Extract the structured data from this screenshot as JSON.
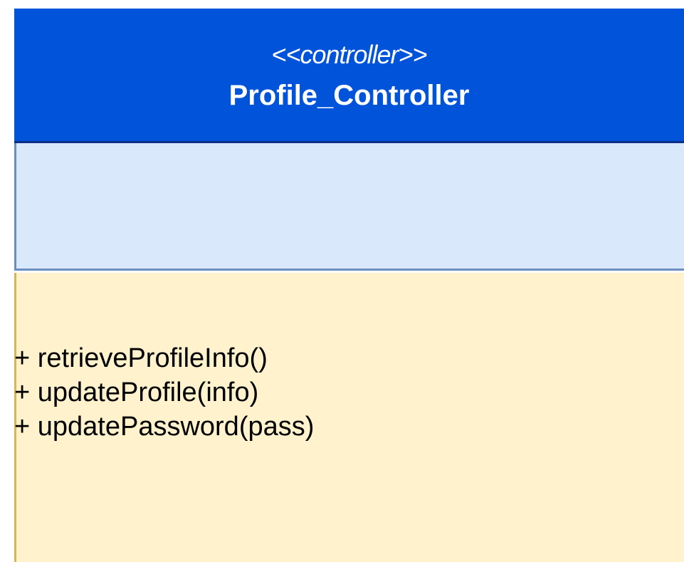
{
  "class": {
    "stereotype": "<<controller>>",
    "name": "Profile_Controller",
    "attributes": [],
    "operations": [
      "+ retrieveProfileInfo()",
      "+ updateProfile(info)",
      "+ updatePassword(pass)"
    ]
  },
  "colors": {
    "header_fill": "#0153d9",
    "header_stroke": "#0d2f87",
    "attributes_fill": "#dae8fc",
    "attributes_stroke": "#6c8ebf",
    "operations_fill": "#fff2cc",
    "operations_stroke": "#d6b656"
  }
}
